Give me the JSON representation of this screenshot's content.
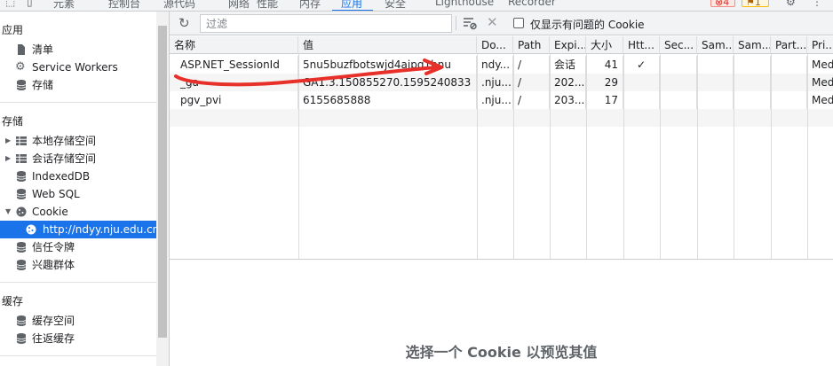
{
  "topbar": {
    "tabs": [
      "元素",
      "控制台",
      "源代码",
      "网络",
      "性能",
      "内存",
      "应用",
      "安全",
      "Lighthouse",
      "Recorder"
    ],
    "active_tab": "应用",
    "error_count": "4",
    "warning_count": "1"
  },
  "sidebar": {
    "app_header": "应用",
    "app_items": [
      {
        "label": "清单",
        "icon": "file-icon"
      },
      {
        "label": "Service Workers",
        "icon": "gear-icon"
      },
      {
        "label": "存储",
        "icon": "database-icon"
      }
    ],
    "storage_header": "存储",
    "storage_items": [
      {
        "label": "本地存储空间",
        "icon": "grid-icon"
      },
      {
        "label": "会话存储空间",
        "icon": "grid-icon"
      },
      {
        "label": "IndexedDB",
        "icon": "database-icon"
      },
      {
        "label": "Web SQL",
        "icon": "database-icon"
      },
      {
        "label": "Cookie",
        "icon": "cookie-icon"
      },
      {
        "label": "http://ndyy.nju.edu.cn",
        "icon": "cookie-icon"
      },
      {
        "label": "信任令牌",
        "icon": "database-icon"
      },
      {
        "label": "兴趣群体",
        "icon": "database-icon"
      }
    ],
    "cache_header": "缓存",
    "cache_items": [
      {
        "label": "缓存空间",
        "icon": "database-icon"
      },
      {
        "label": "往返缓存",
        "icon": "database-icon"
      }
    ]
  },
  "toolbar": {
    "filter_placeholder": "过滤",
    "only_issues_label": "仅显示有问题的 Cookie"
  },
  "table": {
    "headers": [
      "名称",
      "值",
      "Do...",
      "Path",
      "Expi...",
      "大小",
      "Htt...",
      "Sec...",
      "Sam...",
      "Sam...",
      "Part...",
      "Pri..."
    ],
    "rows": [
      [
        "ASP.NET_SessionId",
        "5nu5buzfbotswjd4aipq1bnu",
        "ndy...",
        "/",
        "会话",
        "41",
        "✓",
        "",
        "",
        "",
        "",
        "Med"
      ],
      [
        "_ga",
        "GA1.3.150855270.1595240833",
        ".nju....",
        "/",
        "202...",
        "29",
        "",
        "",
        "",
        "",
        "",
        "Med"
      ],
      [
        "pgv_pvi",
        "6155685888",
        ".nju....",
        "/",
        "203...",
        "17",
        "",
        "",
        "",
        "",
        "",
        "Med"
      ]
    ]
  },
  "preview": {
    "message": "选择一个 Cookie 以预览其值"
  },
  "colors": {
    "accent": "#1a73e8",
    "annotation": "#e8302a"
  }
}
